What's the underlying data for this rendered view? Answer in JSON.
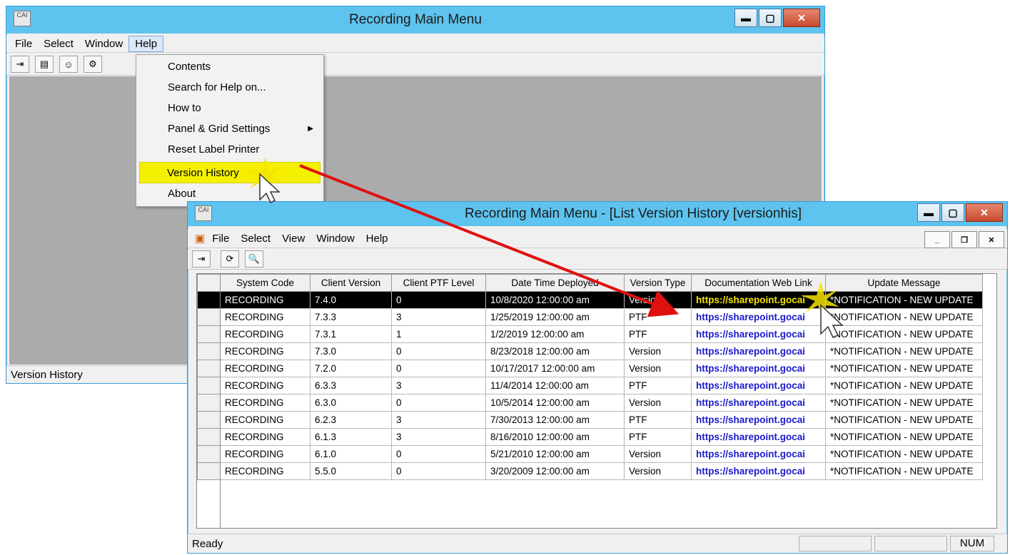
{
  "back_window": {
    "title": "Recording Main Menu",
    "app_icon_text": "CAI",
    "menu": [
      "File",
      "Select",
      "Window",
      "Help"
    ],
    "status": "Version History"
  },
  "help_menu": {
    "items": [
      {
        "label": "Contents"
      },
      {
        "label": "Search for Help on..."
      },
      {
        "label": "How to"
      },
      {
        "label": "Panel & Grid Settings",
        "submenu": true
      },
      {
        "label": "Reset Label Printer"
      },
      {
        "label": "Version History",
        "highlighted": true
      },
      {
        "label": "About"
      }
    ]
  },
  "front_window": {
    "title": "Recording Main Menu - [List Version History [versionhis]",
    "app_icon_text": "CAI",
    "menu": [
      "File",
      "Select",
      "View",
      "Window",
      "Help"
    ],
    "status": "Ready",
    "status_right": "NUM",
    "grid": {
      "columns": [
        "System Code",
        "Client Version",
        "Client PTF Level",
        "Date Time Deployed",
        "Version Type",
        "Documentation Web Link",
        "Update Message"
      ],
      "rows": [
        [
          "RECORDING",
          "7.4.0",
          "0",
          "10/8/2020 12:00:00 am",
          "Version",
          "https://sharepoint.gocai",
          "*NOTIFICATION - NEW UPDATE"
        ],
        [
          "RECORDING",
          "7.3.3",
          "3",
          "1/25/2019 12:00:00 am",
          "PTF",
          "https://sharepoint.gocai",
          "*NOTIFICATION - NEW UPDATE"
        ],
        [
          "RECORDING",
          "7.3.1",
          "1",
          "1/2/2019 12:00:00 am",
          "PTF",
          "https://sharepoint.gocai",
          "*NOTIFICATION - NEW UPDATE"
        ],
        [
          "RECORDING",
          "7.3.0",
          "0",
          "8/23/2018 12:00:00 am",
          "Version",
          "https://sharepoint.gocai",
          "*NOTIFICATION - NEW UPDATE"
        ],
        [
          "RECORDING",
          "7.2.0",
          "0",
          "10/17/2017 12:00:00 am",
          "Version",
          "https://sharepoint.gocai",
          "*NOTIFICATION - NEW UPDATE"
        ],
        [
          "RECORDING",
          "6.3.3",
          "3",
          "11/4/2014 12:00:00 am",
          "PTF",
          "https://sharepoint.gocai",
          "*NOTIFICATION - NEW UPDATE"
        ],
        [
          "RECORDING",
          "6.3.0",
          "0",
          "10/5/2014 12:00:00 am",
          "Version",
          "https://sharepoint.gocai",
          "*NOTIFICATION - NEW UPDATE"
        ],
        [
          "RECORDING",
          "6.2.3",
          "3",
          "7/30/2013 12:00:00 am",
          "PTF",
          "https://sharepoint.gocai",
          "*NOTIFICATION - NEW UPDATE"
        ],
        [
          "RECORDING",
          "6.1.3",
          "3",
          "8/16/2010 12:00:00 am",
          "PTF",
          "https://sharepoint.gocai",
          "*NOTIFICATION - NEW UPDATE"
        ],
        [
          "RECORDING",
          "6.1.0",
          "0",
          "5/21/2010 12:00:00 am",
          "Version",
          "https://sharepoint.gocai",
          "*NOTIFICATION - NEW UPDATE"
        ],
        [
          "RECORDING",
          "5.5.0",
          "0",
          "3/20/2009 12:00:00 am",
          "Version",
          "https://sharepoint.gocai",
          "*NOTIFICATION - NEW UPDATE"
        ]
      ],
      "selected_row": 0
    }
  },
  "colors": {
    "titlebar": "#5ec3ee",
    "highlight_yellow": "#f5f000",
    "link_blue": "#1a1acc",
    "annotation_arrow": "#e01010"
  }
}
